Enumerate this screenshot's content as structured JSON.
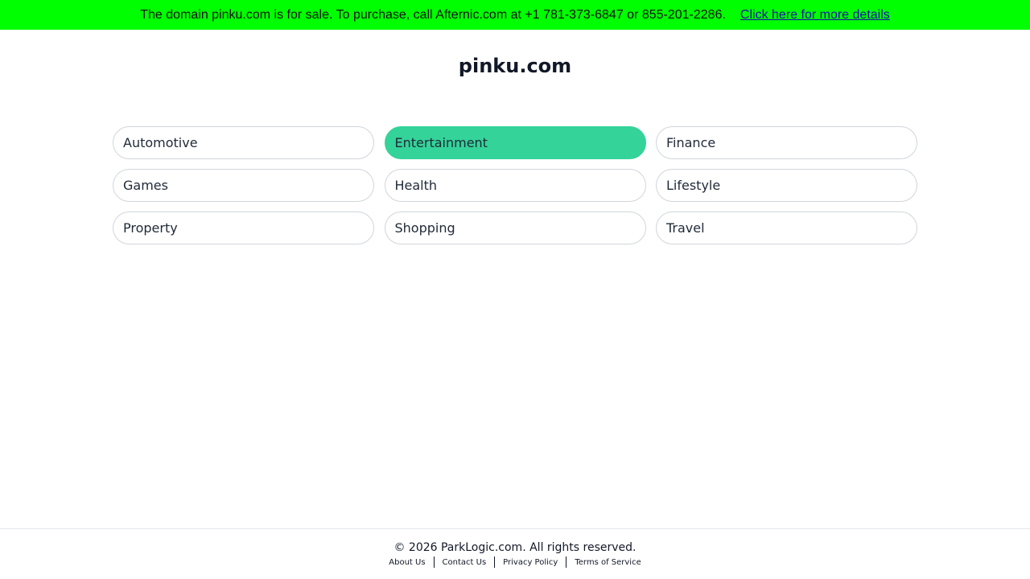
{
  "banner": {
    "text": "The domain pinku.com is for sale. To purchase, call Afternic.com at +1 781-373-6847 or 855-201-2286.",
    "link_label": "Click here for more details",
    "background": "#00ff00"
  },
  "site": {
    "title": "pinku.com"
  },
  "categories": [
    {
      "label": "Automotive",
      "active": false
    },
    {
      "label": "Entertainment",
      "active": true
    },
    {
      "label": "Finance",
      "active": false
    },
    {
      "label": "Games",
      "active": false
    },
    {
      "label": "Health",
      "active": false
    },
    {
      "label": "Lifestyle",
      "active": false
    },
    {
      "label": "Property",
      "active": false
    },
    {
      "label": "Shopping",
      "active": false
    },
    {
      "label": "Travel",
      "active": false
    }
  ],
  "colors": {
    "active_category": "#34d399"
  },
  "footer": {
    "copyright": "© 2026 ParkLogic.com. All rights reserved.",
    "links": {
      "about": "About Us",
      "contact": "Contact Us",
      "privacy": "Privacy Policy",
      "terms": "Terms of Service"
    }
  }
}
